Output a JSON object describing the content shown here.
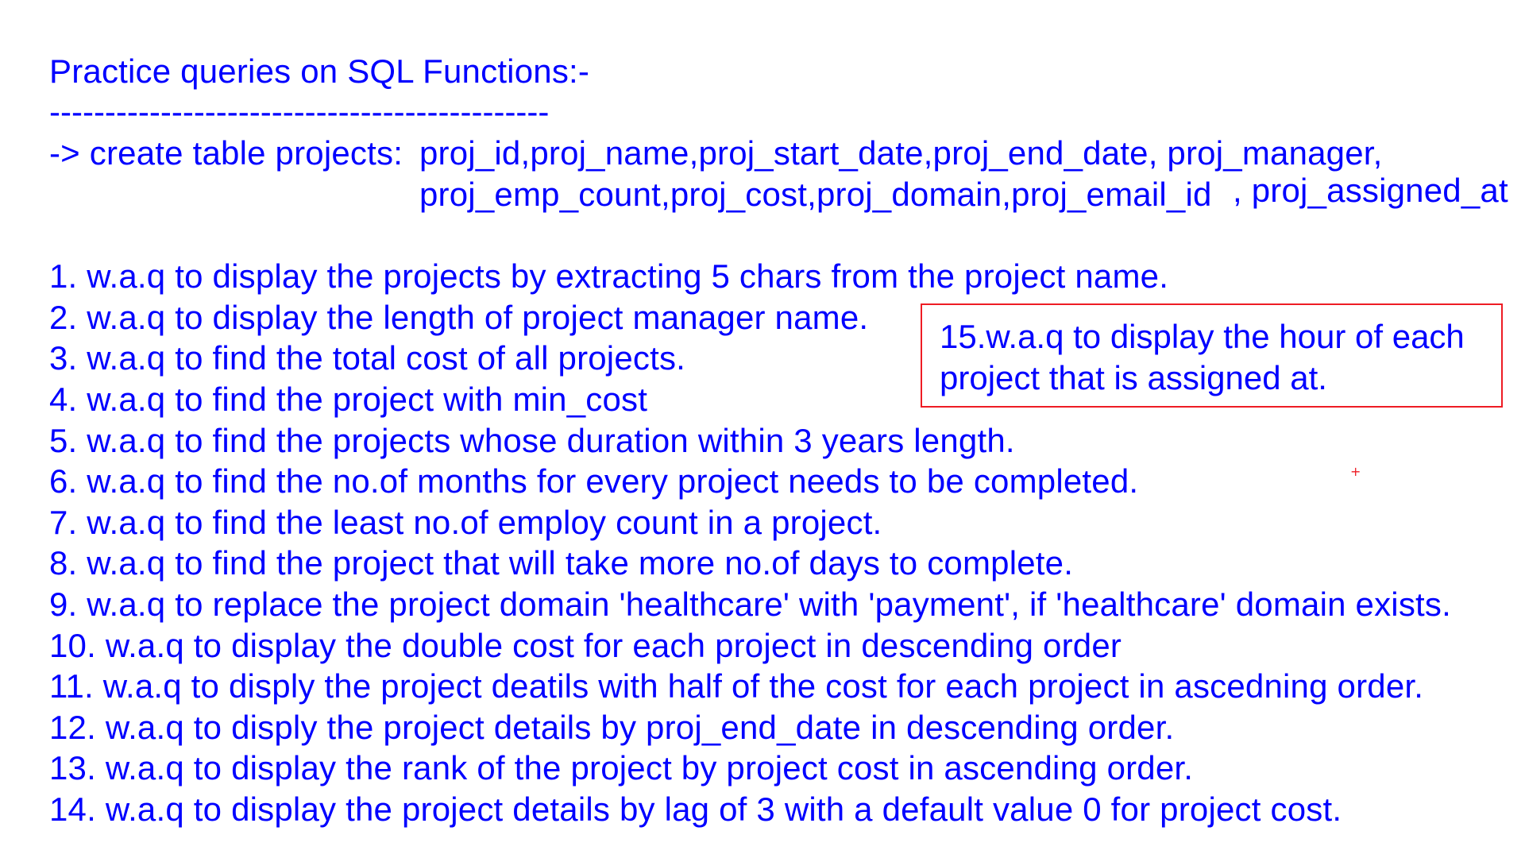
{
  "heading": {
    "title": "Practice queries on SQL Functions:-",
    "divider": "---------------------------------------------"
  },
  "create_table": {
    "label": "-> create table projects:",
    "columns_line1": "proj_id,proj_name,proj_start_date,proj_end_date, proj_manager,",
    "columns_line2": "proj_emp_count,proj_cost,proj_domain,proj_email_id",
    "columns_line2_extra": ", proj_assigned_at"
  },
  "questions": [
    "1. w.a.q to display the projects by extracting 5 chars from the project name.",
    "2. w.a.q to display the length of project manager name.",
    "3. w.a.q to find the total cost of all projects.",
    "4. w.a.q to find the project with min_cost",
    "5. w.a.q to find the projects whose duration within 3 years length.",
    "6. w.a.q to find the no.of months for every project needs to be completed.",
    "7. w.a.q to find the least no.of employ count in a project.",
    "8. w.a.q to find the project that will take more no.of days to complete.",
    "9. w.a.q to replace the project domain 'healthcare' with 'payment', if 'healthcare' domain exists.",
    "10. w.a.q to display the double cost for each project in descending order",
    "11. w.a.q to disply the project deatils with half of the cost for each project in ascedning order.",
    "12. w.a.q to disply the project details by proj_end_date in descending order.",
    "13. w.a.q to display the rank of the project by project cost in ascending order.",
    "14. w.a.q to display the project details by lag of 3 with a default value 0 for project cost."
  ],
  "callout": {
    "text": "15.w.a.q to display the hour of each project that is assigned at."
  },
  "marks": {
    "cursor_plus": "+"
  },
  "colors": {
    "text": "#0000ff",
    "callout_border": "#ee1c24",
    "background": "#ffffff"
  }
}
